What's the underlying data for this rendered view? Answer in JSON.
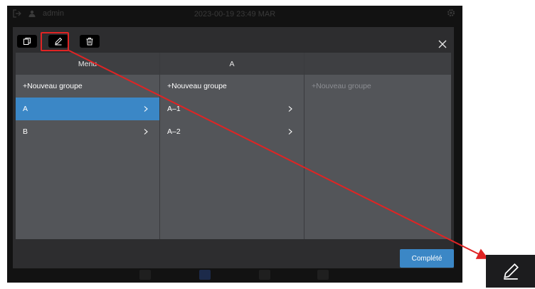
{
  "status_bar": {
    "user": "admin",
    "datetime": "2023-00-19 23:49 MAR"
  },
  "toolbar": {
    "copy_icon": "copy-icon",
    "edit_icon": "pencil-icon",
    "delete_icon": "trash-icon"
  },
  "columns": [
    {
      "header": "Menu",
      "rows": [
        {
          "label": "+Nouveau groupe",
          "chevron": false,
          "selected": false
        },
        {
          "label": "A",
          "chevron": true,
          "selected": true
        },
        {
          "label": "B",
          "chevron": true,
          "selected": false
        }
      ]
    },
    {
      "header": "A",
      "rows": [
        {
          "label": "+Nouveau groupe",
          "chevron": false,
          "selected": false
        },
        {
          "label": "A–1",
          "chevron": true,
          "selected": false
        },
        {
          "label": "A–2",
          "chevron": true,
          "selected": false
        }
      ]
    },
    {
      "header": "",
      "rows": [
        {
          "label": "+Nouveau groupe",
          "chevron": false,
          "selected": false,
          "muted": true
        }
      ]
    }
  ],
  "done_button": "Complété",
  "colors": {
    "accent": "#3b87c6",
    "annotation": "#e02424"
  }
}
